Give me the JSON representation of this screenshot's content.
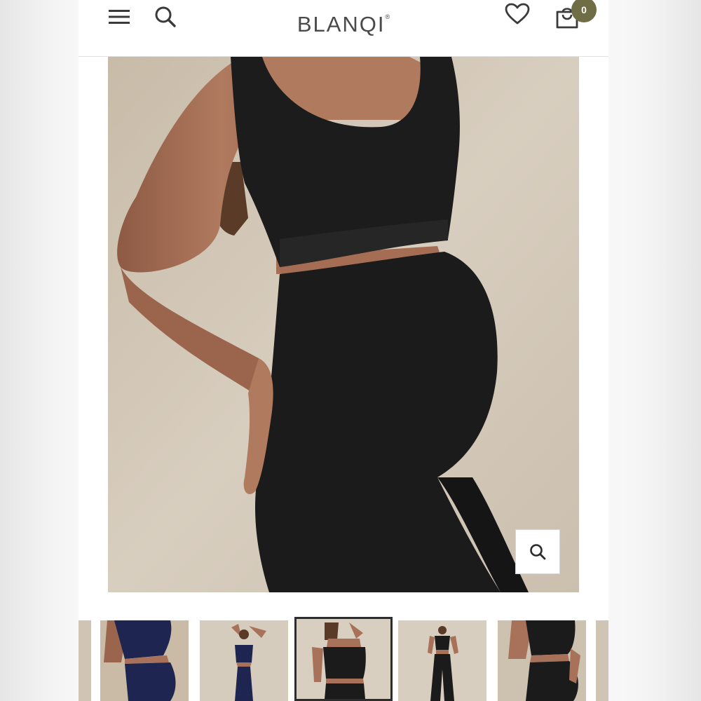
{
  "header": {
    "logo": "BLANQI",
    "logo_mark": "®",
    "cart_count": "0",
    "icons": {
      "menu": "hamburger-menu-icon",
      "search": "search-icon",
      "wishlist": "heart-icon",
      "cart": "shopping-bag-icon"
    }
  },
  "product_gallery": {
    "main_image": "model-black-ribbed-crop-top-and-maternity-leggings",
    "zoom_icon": "search-icon",
    "thumbnails": [
      {
        "name": "thumb-partial-left",
        "top_color": "#1d2550",
        "bottom_color": "#1d2550"
      },
      {
        "name": "thumb-navy-side",
        "top_color": "#1d2550",
        "bottom_color": "#1d2550"
      },
      {
        "name": "thumb-navy-front-pose",
        "top_color": "#1d2550",
        "bottom_color": "#1d2550"
      },
      {
        "name": "thumb-black-front",
        "top_color": "#1a1a1a",
        "bottom_color": "#1a1a1a",
        "selected": true
      },
      {
        "name": "thumb-black-full",
        "top_color": "#1a1a1a",
        "bottom_color": "#1a1a1a"
      },
      {
        "name": "thumb-black-side",
        "top_color": "#1a1a1a",
        "bottom_color": "#1a1a1a"
      }
    ]
  },
  "colors": {
    "badge": "#6f6d45",
    "text": "#4a4a4a",
    "garment_black": "#1b1b1b",
    "garment_navy": "#1d2550",
    "skin": "#a8725a"
  }
}
